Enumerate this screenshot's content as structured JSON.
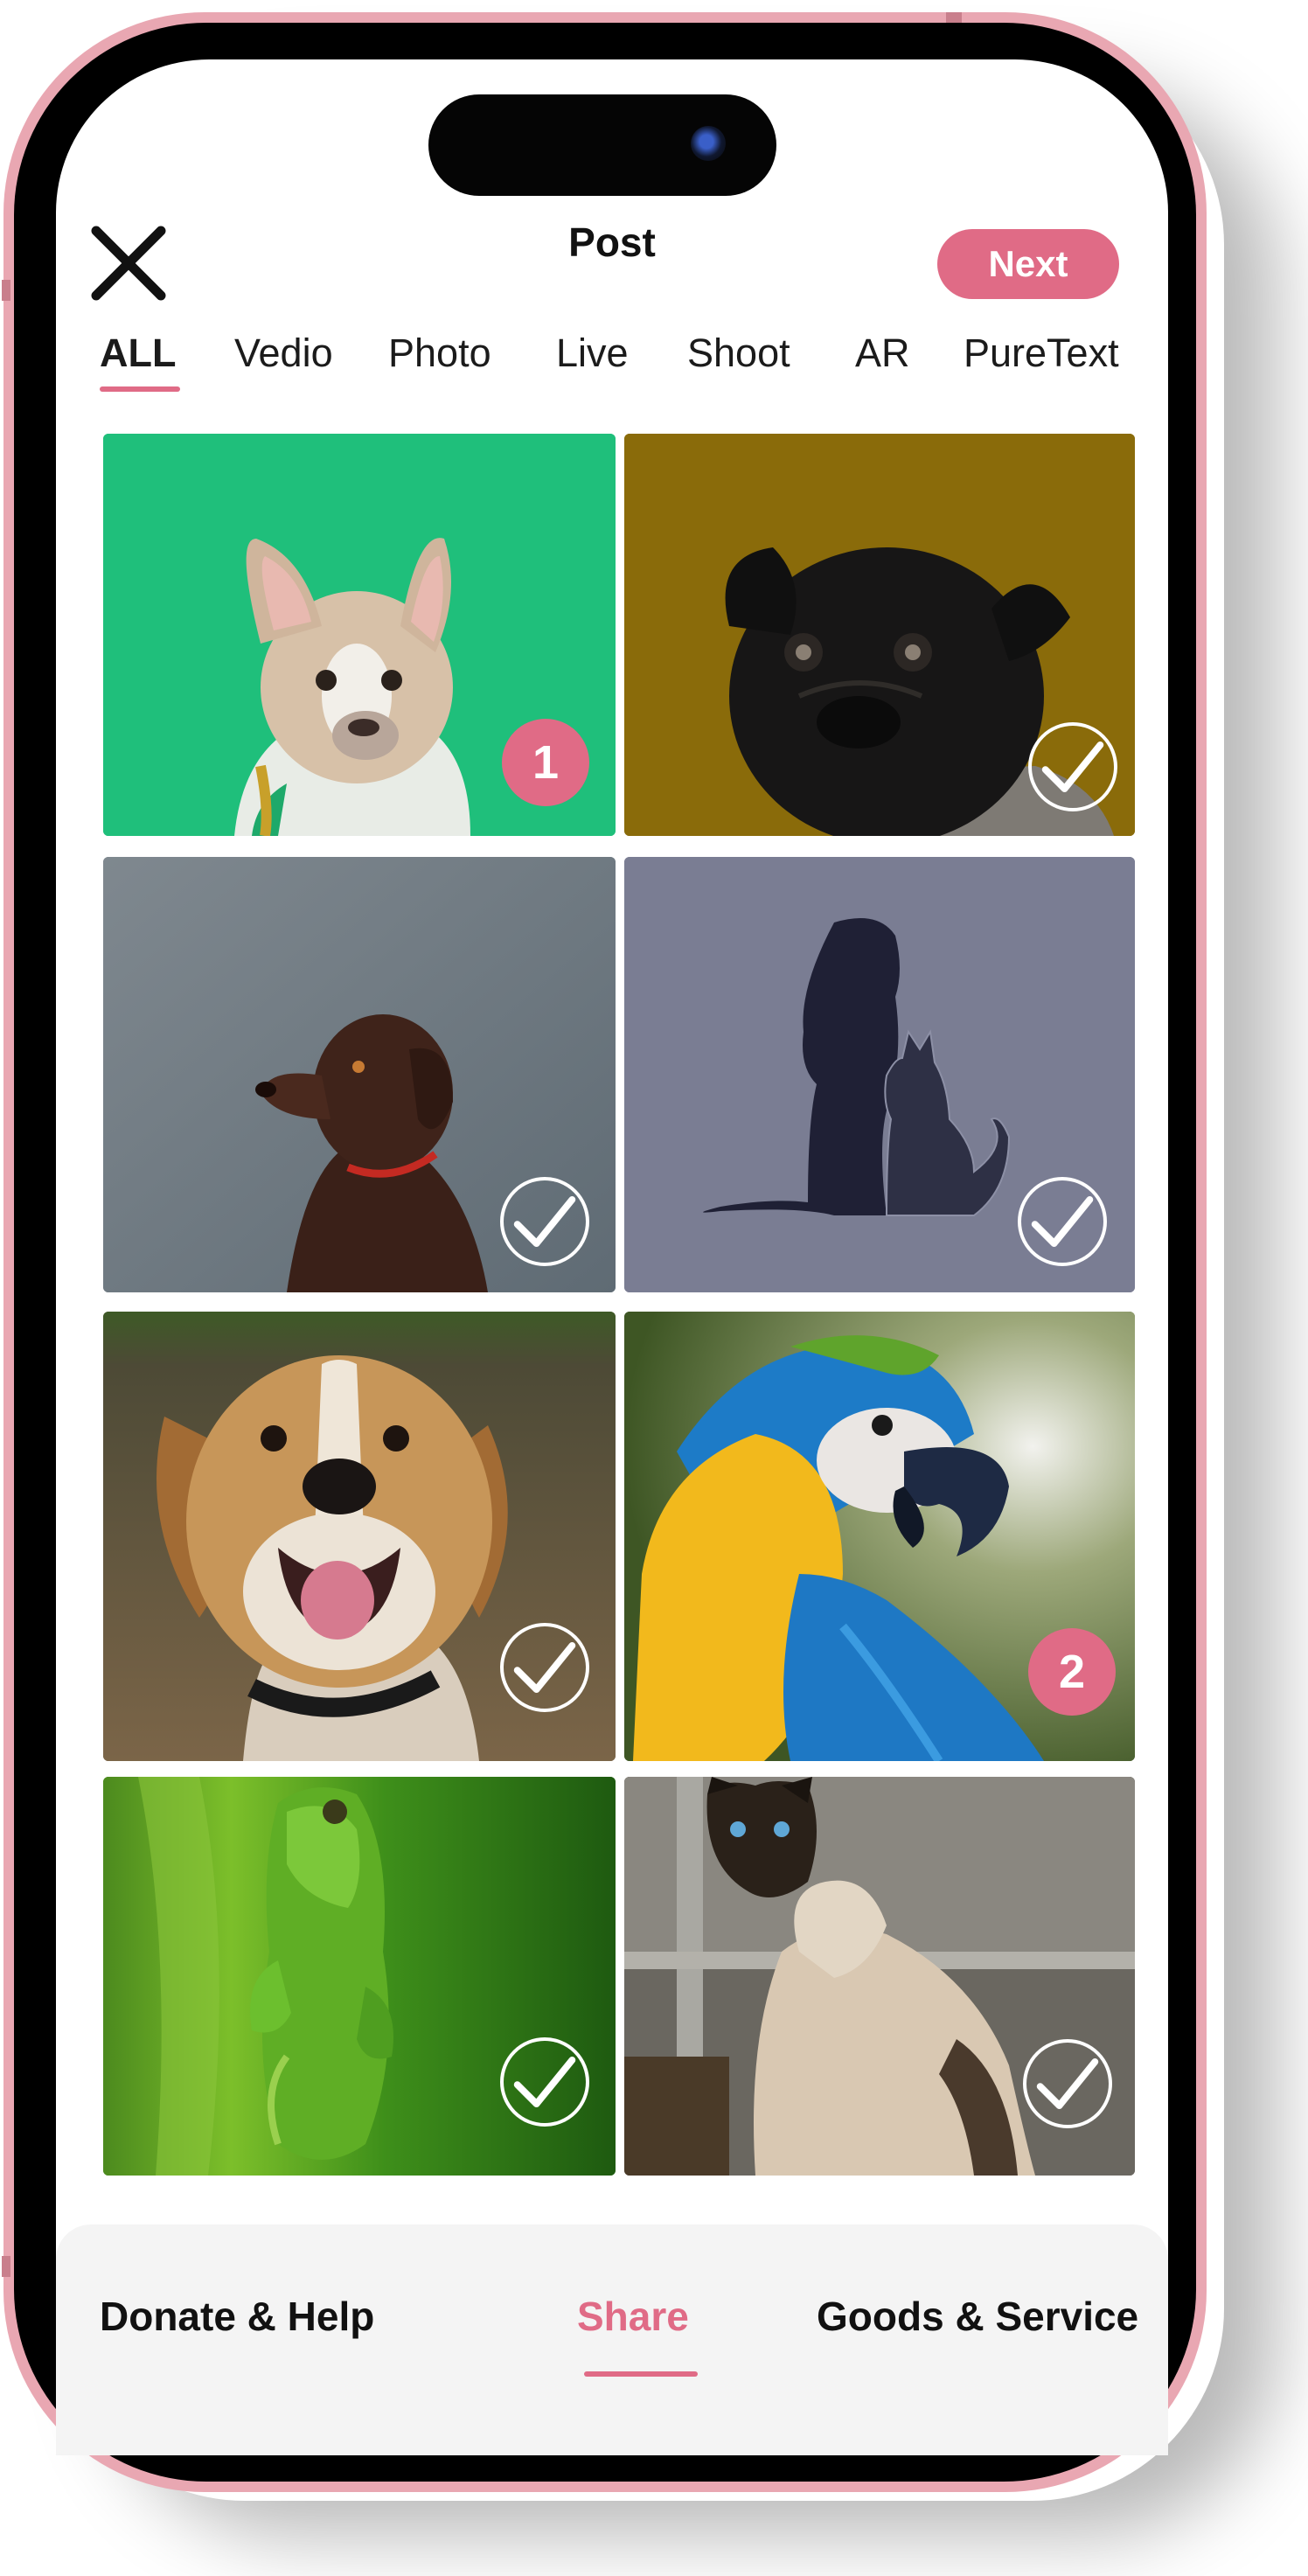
{
  "header": {
    "title": "Post",
    "next_label": "Next"
  },
  "tabs": [
    {
      "label": "ALL",
      "active": true
    },
    {
      "label": "Vedio",
      "active": false
    },
    {
      "label": "Photo",
      "active": false
    },
    {
      "label": "Live",
      "active": false
    },
    {
      "label": "Shoot",
      "active": false
    },
    {
      "label": "AR",
      "active": false
    },
    {
      "label": "PureText",
      "active": false
    }
  ],
  "grid": {
    "items": [
      {
        "subject": "french-bulldog",
        "background": "#1fbf7b",
        "selection": "1"
      },
      {
        "subject": "pug",
        "background": "#8a6b0a",
        "selection": "check"
      },
      {
        "subject": "chocolate-labrador",
        "background": "#6f7b84",
        "selection": "check"
      },
      {
        "subject": "dog-and-cat-silhouette",
        "background": "#7a7d93",
        "selection": "check"
      },
      {
        "subject": "beagle",
        "background": "#6e5a3e",
        "selection": "check"
      },
      {
        "subject": "macaw-parrot",
        "background": "#4f6a30",
        "selection": "2"
      },
      {
        "subject": "green-frog",
        "background": "#2f7a18",
        "selection": "check"
      },
      {
        "subject": "siamese-cat",
        "background": "#5b574f",
        "selection": "check"
      }
    ]
  },
  "bottom_nav": {
    "items": [
      {
        "label": "Donate & Help",
        "active": false
      },
      {
        "label": "Share",
        "active": true
      },
      {
        "label": "Goods & Service",
        "active": false
      }
    ]
  },
  "colors": {
    "accent": "#e06b86",
    "phone_frame": "#e9a7b2",
    "bottom_bar": "#f4f4f4"
  }
}
